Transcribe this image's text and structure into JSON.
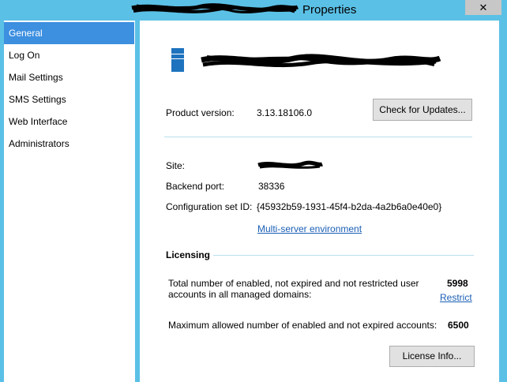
{
  "window": {
    "title": "Properties",
    "close_glyph": "✕"
  },
  "sidebar": {
    "items": [
      {
        "label": "General",
        "active": true
      },
      {
        "label": "Log On"
      },
      {
        "label": "Mail Settings"
      },
      {
        "label": "SMS Settings"
      },
      {
        "label": "Web Interface"
      },
      {
        "label": "Administrators"
      }
    ]
  },
  "general": {
    "product_version_label": "Product version:",
    "product_version_value": "3.13.18106.0",
    "check_updates_label": "Check for Updates...",
    "site_label": "Site:",
    "backend_port_label": "Backend port:",
    "backend_port_value": "38336",
    "config_set_label": "Configuration set ID:",
    "config_set_value": "{45932b59-1931-45f4-b2da-4a2b6a0e40e0}",
    "multi_server_link": "Multi-server environment"
  },
  "licensing": {
    "heading": "Licensing",
    "total_label": "Total number of enabled, not expired and not restricted user accounts in all managed domains:",
    "total_value": "5998",
    "restrict_link": "Restrict",
    "max_label": "Maximum allowed number of enabled and not expired accounts:",
    "max_value": "6500",
    "license_info_label": "License Info..."
  },
  "colors": {
    "frame": "#5bc0e6",
    "selection": "#3d8fe0",
    "link": "#1a5fb4",
    "app_icon": "#1e73be"
  },
  "icons": [
    "close-icon",
    "app-icon"
  ]
}
